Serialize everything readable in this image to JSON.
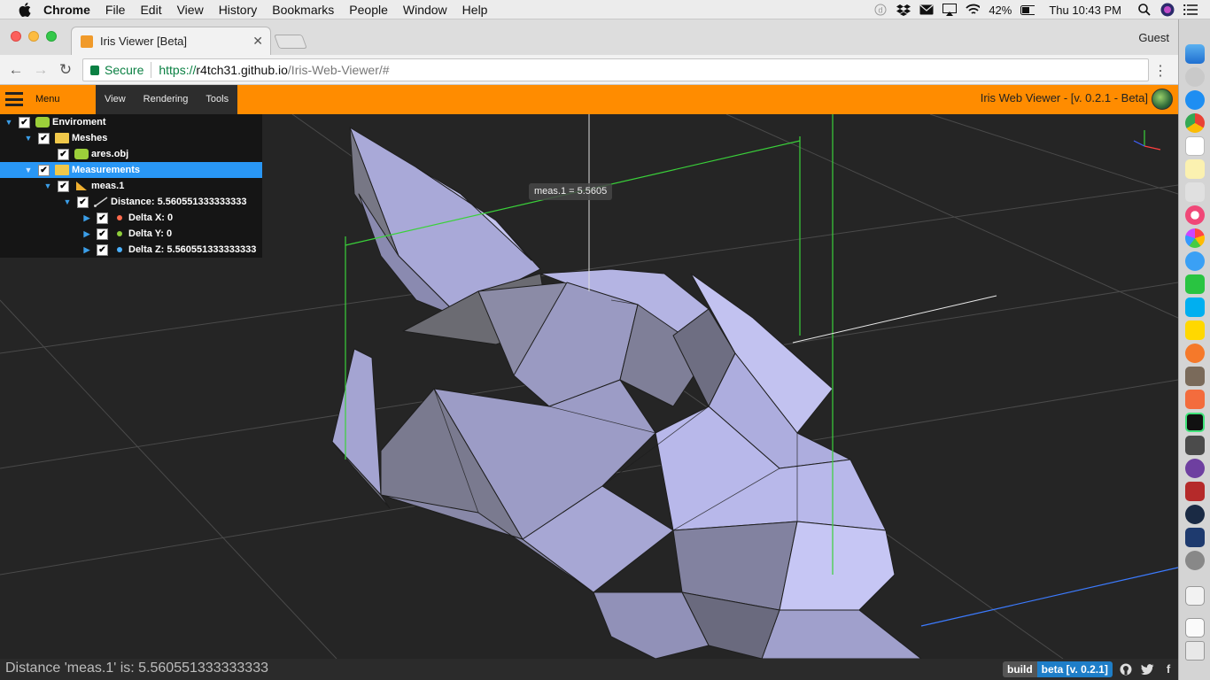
{
  "macos_menubar": {
    "app_name": "Chrome",
    "menus": [
      "File",
      "Edit",
      "View",
      "History",
      "Bookmarks",
      "People",
      "Window",
      "Help"
    ],
    "battery": "42%",
    "clock": "Thu 10:43 PM"
  },
  "browser": {
    "tab_title": "Iris Viewer [Beta]",
    "profile": "Guest",
    "secure_label": "Secure",
    "url_scheme": "https://",
    "url_host": "r4tch31.github.io",
    "url_path": "/Iris-Web-Viewer/#"
  },
  "appbar": {
    "menu_label": "Menu",
    "tabs": [
      "View",
      "Rendering",
      "Tools"
    ],
    "title": "Iris Web Viewer - [v. 0.2.1 - Beta]"
  },
  "tree": [
    {
      "label": "Enviroment",
      "selected": false
    },
    {
      "label": "Meshes",
      "selected": false
    },
    {
      "label": "ares.obj",
      "selected": false
    },
    {
      "label": "Measurements",
      "selected": true
    },
    {
      "label": "meas.1",
      "selected": false
    },
    {
      "label": "Distance: 5.560551333333333",
      "selected": false
    },
    {
      "label": "Delta X: 0",
      "dot_color": "#ff6a4d"
    },
    {
      "label": "Delta Y: 0",
      "dot_color": "#8fce3b"
    },
    {
      "label": "Delta Z: 5.560551333333333",
      "dot_color": "#4ab1ff"
    }
  ],
  "viewport": {
    "measurement_label": "meas.1 = 5.5605",
    "mesh_color": "#b4b4e6"
  },
  "statusbar": {
    "message": "Distance 'meas.1' is: 5.560551333333333",
    "build_label": "build",
    "build_version": "beta [v. 0.2.1]"
  },
  "colors": {
    "accent": "#ff8c00",
    "selection": "#2997f5",
    "measure_line": "#3ad13a"
  }
}
